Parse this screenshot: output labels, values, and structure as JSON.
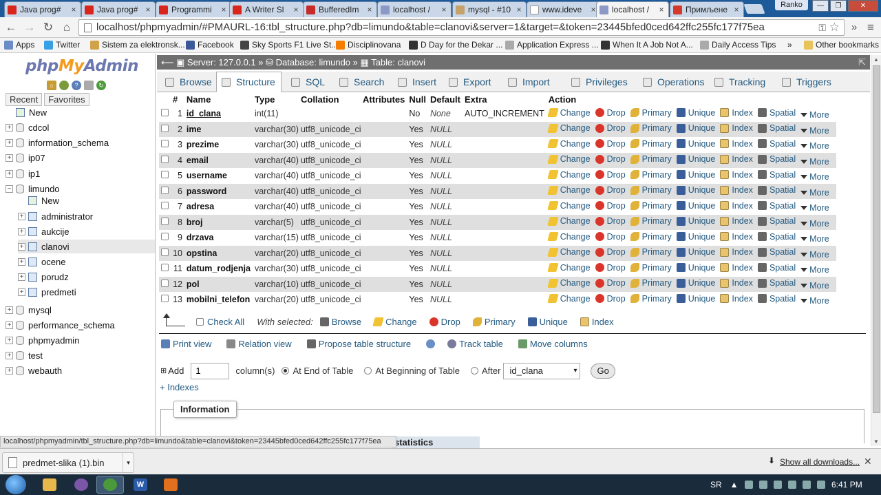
{
  "browser": {
    "tabs": [
      {
        "title": "Java prog#",
        "fav": "youtube",
        "color": "#d9261c",
        "active": false
      },
      {
        "title": "Java prog#",
        "fav": "youtube",
        "color": "#d9261c",
        "active": false
      },
      {
        "title": "Programmi",
        "fav": "youtube",
        "color": "#d9261c",
        "active": false
      },
      {
        "title": "A Writer Sl",
        "fav": "youtube",
        "color": "#d9261c",
        "active": false
      },
      {
        "title": "BufferedIm",
        "fav": "oracle",
        "color": "#c62b28",
        "active": false
      },
      {
        "title": "localhost /",
        "fav": "pma",
        "color": "#8c99c6",
        "active": false
      },
      {
        "title": "mysql - #10",
        "fav": "stack",
        "color": "#c5a26a",
        "active": false
      },
      {
        "title": "www.ideve",
        "fav": "page",
        "color": "#ffffff",
        "active": false
      },
      {
        "title": "localhost /",
        "fav": "pma",
        "color": "#8c99c6",
        "active": true
      },
      {
        "title": "Примљене",
        "fav": "gmail",
        "color": "#d33a2c",
        "active": false
      }
    ],
    "user": "Ranko",
    "url_prefix": "localhost/phpmyadmin/",
    "url_path": "#PMAURL-16:tbl_structure.php?db=limundo&table=clanovi&server=1&target=&token=23445bfed0ced642ffc255fc177f75ea",
    "bookmarks": [
      {
        "label": "Apps",
        "icon": "apps-icon",
        "color": "#6b8cc7"
      },
      {
        "label": "Twitter",
        "icon": "twitter-icon",
        "color": "#3aa0e6"
      },
      {
        "label": "Sistem za elektronsk...",
        "icon": "bookmark-icon",
        "color": "#d0a24a"
      },
      {
        "label": "Facebook",
        "icon": "facebook-icon",
        "color": "#3b5998"
      },
      {
        "label": "Sky Sports F1 Live St...",
        "icon": "sky-icon",
        "color": "#444"
      },
      {
        "label": "Disciplinovana",
        "icon": "blogger-icon",
        "color": "#f57d00"
      },
      {
        "label": "D Day for the Dekar ...",
        "icon": "bookmark-icon",
        "color": "#333"
      },
      {
        "label": "Application Express ...",
        "icon": "page-icon",
        "color": "#aaa"
      },
      {
        "label": "When It A Job Not A...",
        "icon": "bookmark-icon",
        "color": "#333"
      },
      {
        "label": "Daily Access Tips",
        "icon": "page-icon",
        "color": "#aaa"
      }
    ],
    "other_bookmarks": "Other bookmarks",
    "bookmarks_overflow": "»"
  },
  "nav": {
    "logo_php": "php",
    "logo_my": "My",
    "logo_admin": "Admin",
    "tabs": [
      "Recent",
      "Favorites"
    ],
    "tree": [
      {
        "label": "New",
        "level": 0,
        "kind": "new"
      },
      {
        "label": "cdcol",
        "level": 0,
        "kind": "db"
      },
      {
        "label": "information_schema",
        "level": 0,
        "kind": "db"
      },
      {
        "label": "ip07",
        "level": 0,
        "kind": "db"
      },
      {
        "label": "ip1",
        "level": 0,
        "kind": "db"
      },
      {
        "label": "limundo",
        "level": 0,
        "kind": "db-open"
      },
      {
        "label": "New",
        "level": 1,
        "kind": "new"
      },
      {
        "label": "administrator",
        "level": 1,
        "kind": "table"
      },
      {
        "label": "aukcije",
        "level": 1,
        "kind": "table"
      },
      {
        "label": "clanovi",
        "level": 1,
        "kind": "table",
        "selected": true
      },
      {
        "label": "ocene",
        "level": 1,
        "kind": "table"
      },
      {
        "label": "porudz",
        "level": 1,
        "kind": "table"
      },
      {
        "label": "predmeti",
        "level": 1,
        "kind": "table"
      },
      {
        "label": "mysql",
        "level": 0,
        "kind": "db"
      },
      {
        "label": "performance_schema",
        "level": 0,
        "kind": "db"
      },
      {
        "label": "phpmyadmin",
        "level": 0,
        "kind": "db"
      },
      {
        "label": "test",
        "level": 0,
        "kind": "db"
      },
      {
        "label": "webauth",
        "level": 0,
        "kind": "db"
      }
    ]
  },
  "breadcrumb": {
    "server_label": "Server: 127.0.0.1",
    "database_label": "Database: limundo",
    "table_label": "Table: clanovi",
    "sep": "»"
  },
  "tabs": [
    "Browse",
    "Structure",
    "SQL",
    "Search",
    "Insert",
    "Export",
    "Import",
    "Privileges",
    "Operations",
    "Tracking",
    "Triggers"
  ],
  "active_tab": "Structure",
  "table": {
    "headers": [
      "#",
      "Name",
      "Type",
      "Collation",
      "Attributes",
      "Null",
      "Default",
      "Extra",
      "Action"
    ],
    "rows": [
      {
        "n": "1",
        "name": "id_clana",
        "type": "int(11)",
        "collation": "",
        "attributes": "",
        "null": "No",
        "default": "None",
        "extra": "AUTO_INCREMENT",
        "pk": true
      },
      {
        "n": "2",
        "name": "ime",
        "type": "varchar(30)",
        "collation": "utf8_unicode_ci",
        "attributes": "",
        "null": "Yes",
        "default": "NULL",
        "extra": ""
      },
      {
        "n": "3",
        "name": "prezime",
        "type": "varchar(30)",
        "collation": "utf8_unicode_ci",
        "attributes": "",
        "null": "Yes",
        "default": "NULL",
        "extra": ""
      },
      {
        "n": "4",
        "name": "email",
        "type": "varchar(40)",
        "collation": "utf8_unicode_ci",
        "attributes": "",
        "null": "Yes",
        "default": "NULL",
        "extra": ""
      },
      {
        "n": "5",
        "name": "username",
        "type": "varchar(40)",
        "collation": "utf8_unicode_ci",
        "attributes": "",
        "null": "Yes",
        "default": "NULL",
        "extra": ""
      },
      {
        "n": "6",
        "name": "password",
        "type": "varchar(40)",
        "collation": "utf8_unicode_ci",
        "attributes": "",
        "null": "Yes",
        "default": "NULL",
        "extra": ""
      },
      {
        "n": "7",
        "name": "adresa",
        "type": "varchar(40)",
        "collation": "utf8_unicode_ci",
        "attributes": "",
        "null": "Yes",
        "default": "NULL",
        "extra": ""
      },
      {
        "n": "8",
        "name": "broj",
        "type": "varchar(5)",
        "collation": "utf8_unicode_ci",
        "attributes": "",
        "null": "Yes",
        "default": "NULL",
        "extra": ""
      },
      {
        "n": "9",
        "name": "drzava",
        "type": "varchar(15)",
        "collation": "utf8_unicode_ci",
        "attributes": "",
        "null": "Yes",
        "default": "NULL",
        "extra": ""
      },
      {
        "n": "10",
        "name": "opstina",
        "type": "varchar(20)",
        "collation": "utf8_unicode_ci",
        "attributes": "",
        "null": "Yes",
        "default": "NULL",
        "extra": ""
      },
      {
        "n": "11",
        "name": "datum_rodjenja",
        "type": "varchar(30)",
        "collation": "utf8_unicode_ci",
        "attributes": "",
        "null": "Yes",
        "default": "NULL",
        "extra": ""
      },
      {
        "n": "12",
        "name": "pol",
        "type": "varchar(10)",
        "collation": "utf8_unicode_ci",
        "attributes": "",
        "null": "Yes",
        "default": "NULL",
        "extra": ""
      },
      {
        "n": "13",
        "name": "mobilni_telefon",
        "type": "varchar(20)",
        "collation": "utf8_unicode_ci",
        "attributes": "",
        "null": "Yes",
        "default": "NULL",
        "extra": ""
      }
    ],
    "actions": [
      {
        "label": "Change",
        "icon": "pencil"
      },
      {
        "label": "Drop",
        "icon": "drop"
      },
      {
        "label": "Primary",
        "icon": "key"
      },
      {
        "label": "Unique",
        "icon": "uniq"
      },
      {
        "label": "Index",
        "icon": "index"
      },
      {
        "label": "Spatial",
        "icon": "spatial"
      },
      {
        "label": "More",
        "icon": "more"
      }
    ]
  },
  "bulk": {
    "check_all": "Check All",
    "with_selected": "With selected:",
    "actions": [
      {
        "label": "Browse",
        "icon": "spatial"
      },
      {
        "label": "Change",
        "icon": "pencil"
      },
      {
        "label": "Drop",
        "icon": "drop"
      },
      {
        "label": "Primary",
        "icon": "key"
      },
      {
        "label": "Unique",
        "icon": "uniq"
      },
      {
        "label": "Index",
        "icon": "index"
      }
    ]
  },
  "links": {
    "print_view": "Print view",
    "relation_view": "Relation view",
    "propose": "Propose table structure",
    "track": "Track table",
    "move_columns": "Move columns"
  },
  "add_columns": {
    "label": "Add",
    "count": "1",
    "suffix": "column(s)",
    "opt_end": "At End of Table",
    "opt_begin": "At Beginning of Table",
    "opt_after": "After",
    "after_value": "id_clana",
    "go": "Go"
  },
  "indexes_link": "+ Indexes",
  "information_legend": "Information",
  "statusbar_url": "localhost/phpmyadmin/tbl_structure.php?db=limundo&table=clanovi&token=23445bfed0ced642ffc255fc177f75ea",
  "statistics_tab": "statistics",
  "download": {
    "file": "predmet-slika (1).bin",
    "show_all": "Show all downloads..."
  },
  "taskbar": {
    "lang": "SR",
    "time": "6:41 PM"
  }
}
